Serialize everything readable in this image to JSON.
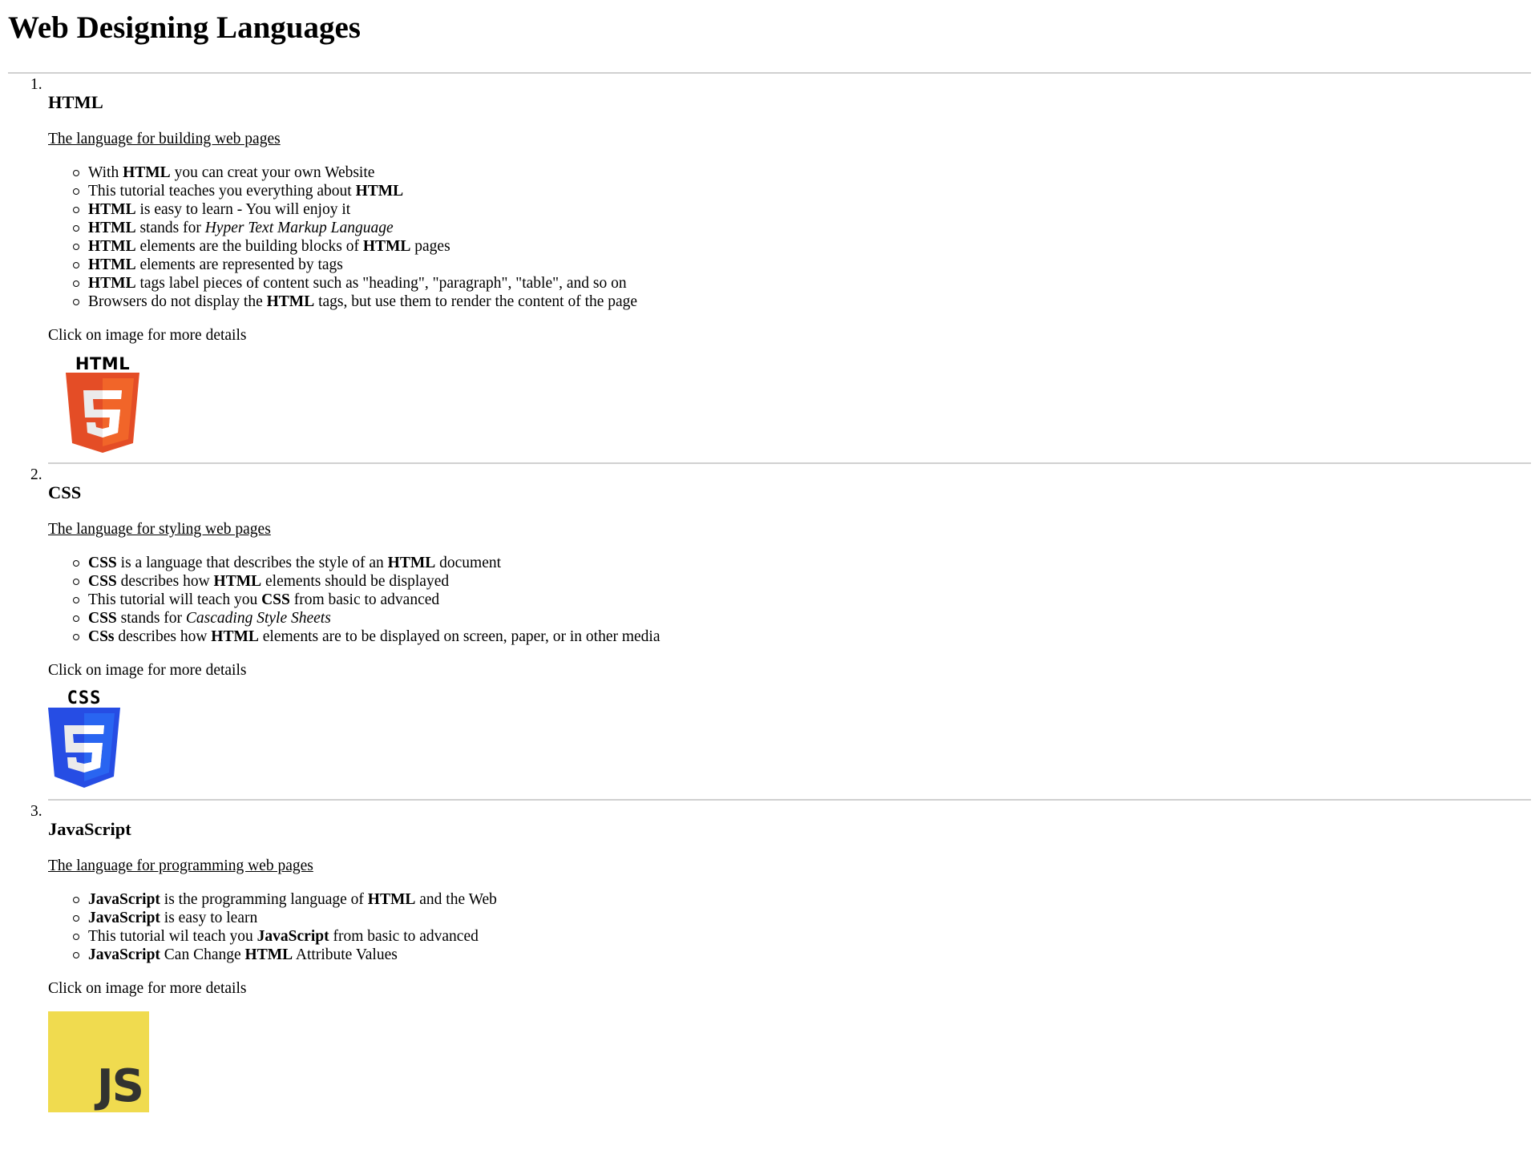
{
  "page_title": "Web Designing Languages",
  "click_note": "Click on image for more details",
  "languages": [
    {
      "number": "1.",
      "name": "HTML",
      "tagline": "The language for building web pages",
      "logo_text": "HTML",
      "logo_icon": "html5-logo",
      "points_html": [
        "With <b>HTML</b> you can creat your own Website",
        "This tutorial teaches you everything about <b>HTML</b>",
        "<b>HTML</b> is easy to learn - You will enjoy it",
        "<b>HTML</b> stands for <i>Hyper Text Markup Language</i>",
        "<b>HTML</b> elements are the building blocks of <b>HTML</b> pages",
        "<b>HTML</b> elements are represented by tags",
        "<b>HTML</b> tags label pieces of content such as \"heading\", \"paragraph\", \"table\", and so on",
        "Browsers do not display the <b>HTML</b> tags, but use them to render the content of the page"
      ]
    },
    {
      "number": "2.",
      "name": "CSS",
      "tagline": "The language for styling web pages",
      "logo_text": "CSS",
      "logo_icon": "css3-logo",
      "points_html": [
        "<b>CSS</b> is a language that describes the style of an <b>HTML</b> document",
        "<b>CSS</b> describes how <b>HTML</b> elements should be displayed",
        "This tutorial will teach you <b>CSS</b> from basic to advanced",
        "<b>CSS</b> stands for <i>Cascading Style Sheets</i>",
        "<b>CSs</b> describes how <b>HTML</b> elements are to be displayed on screen, paper, or in other media"
      ]
    },
    {
      "number": "3.",
      "name": "JavaScript",
      "tagline": "The language for programming web pages",
      "logo_text": "JS",
      "logo_icon": "javascript-logo",
      "points_html": [
        "<b>JavaScript</b> is the programming language of <b>HTML</b> and the Web",
        "<b>JavaScript</b> is easy to learn",
        "This tutorial wil teach you <b>JavaScript</b> from basic to advanced",
        "<b>JavaScript</b> Can Change <b>HTML</b> Attribute Values"
      ]
    }
  ],
  "colors": {
    "html_orange": "#e44d26",
    "html_orange_light": "#f16529",
    "css_blue": "#264de4",
    "css_blue_light": "#2965f1",
    "js_yellow": "#f0db4f",
    "js_text": "#323330",
    "rule_gray": "#d0d0d0"
  }
}
